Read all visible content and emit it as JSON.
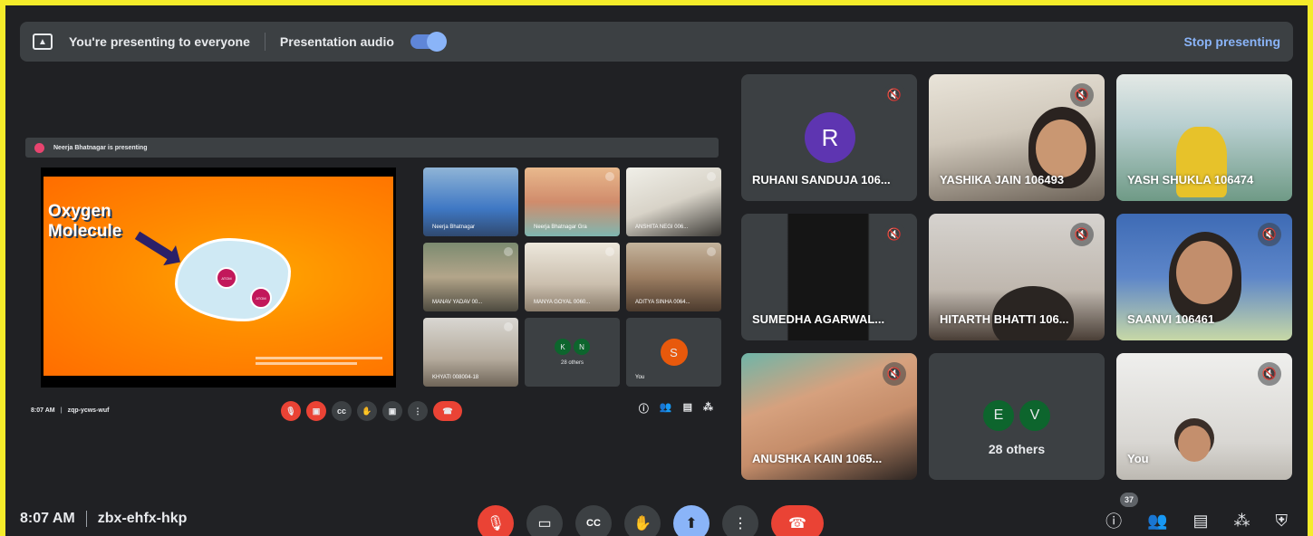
{
  "banner": {
    "presenting_text": "You're presenting to everyone",
    "audio_label": "Presentation audio",
    "stop_label": "Stop presenting"
  },
  "shared_screen": {
    "presenter_text": "Neerja Bhatnagar is presenting",
    "slide": {
      "title_line1": "Oxygen",
      "title_line2": "Molecule",
      "atom1": "ATOM",
      "atom2": "ATOM"
    },
    "tiles": [
      {
        "name": "Neerja Bhatnagar"
      },
      {
        "name": "Neerja Bhatnagar Gra"
      },
      {
        "name": "ANSHITA NEGI 006..."
      },
      {
        "name": "MANAV YADAV 00..."
      },
      {
        "name": "MANYA GOYAL 0060..."
      },
      {
        "name": "ADITYA SINHA 0064..."
      },
      {
        "name": "KHYATI 008004-18"
      },
      {
        "name": "28 others",
        "i1": "K",
        "i2": "N"
      },
      {
        "name": "You",
        "initial": "S"
      }
    ],
    "time": "8:07 AM",
    "code": "zqp-ycws-wuf"
  },
  "participants": [
    {
      "name": "RUHANI SANDUJA 106...",
      "initial": "R"
    },
    {
      "name": "YASHIKA JAIN 106493"
    },
    {
      "name": "YASH SHUKLA 106474"
    },
    {
      "name": "SUMEDHA AGARWAL..."
    },
    {
      "name": "HITARTH BHATTI 106..."
    },
    {
      "name": "SAANVI 106461"
    },
    {
      "name": "ANUSHKA KAIN 1065..."
    },
    {
      "name": "28 others",
      "i1": "E",
      "i2": "V"
    },
    {
      "name": "You"
    }
  ],
  "bottom": {
    "time": "8:07 AM",
    "meeting_code": "zbx-ehfx-hkp",
    "participants_count": "37"
  },
  "colors": {
    "background": "#202124",
    "tile": "#3c4043",
    "red": "#ea4335",
    "blue": "#8ab4f8",
    "frame": "#f5ec2a"
  }
}
